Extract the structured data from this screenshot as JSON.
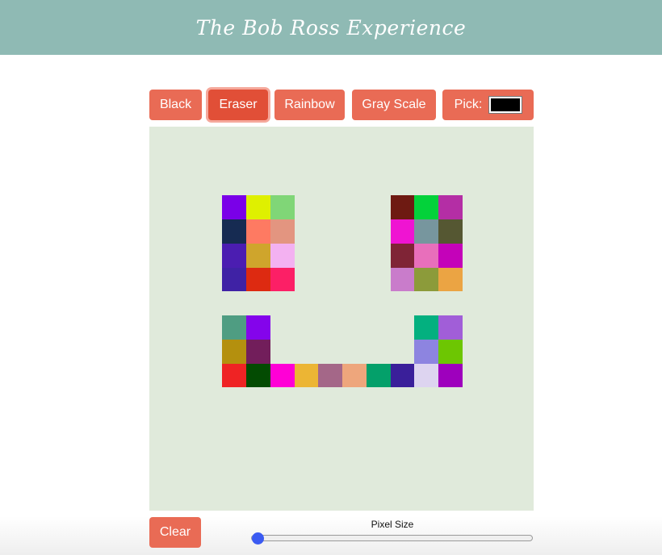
{
  "header": {
    "title": "The Bob Ross Experience"
  },
  "toolbar": {
    "black_label": "Black",
    "eraser_label": "Eraser",
    "rainbow_label": "Rainbow",
    "grayscale_label": "Gray Scale",
    "pick_label": "Pick:",
    "pick_color": "#000000",
    "active_mode": "Eraser"
  },
  "canvas": {
    "background": "#e0eadb",
    "grid_size": 16,
    "pixels": [
      {
        "col": 3,
        "row": 3,
        "color": "#7a00e8"
      },
      {
        "col": 4,
        "row": 3,
        "color": "#dff000"
      },
      {
        "col": 5,
        "row": 3,
        "color": "#80d677"
      },
      {
        "col": 3,
        "row": 4,
        "color": "#162b52"
      },
      {
        "col": 4,
        "row": 4,
        "color": "#fe7a62"
      },
      {
        "col": 5,
        "row": 4,
        "color": "#e39580"
      },
      {
        "col": 3,
        "row": 5,
        "color": "#4b1db1"
      },
      {
        "col": 4,
        "row": 5,
        "color": "#cfa52c"
      },
      {
        "col": 5,
        "row": 5,
        "color": "#f3b1f1"
      },
      {
        "col": 3,
        "row": 6,
        "color": "#3f22a5"
      },
      {
        "col": 4,
        "row": 6,
        "color": "#dd2a11"
      },
      {
        "col": 5,
        "row": 6,
        "color": "#fc1f66"
      },
      {
        "col": 10,
        "row": 3,
        "color": "#6e1a12"
      },
      {
        "col": 11,
        "row": 3,
        "color": "#03d23a"
      },
      {
        "col": 12,
        "row": 3,
        "color": "#b42ea5"
      },
      {
        "col": 10,
        "row": 4,
        "color": "#ef14d2"
      },
      {
        "col": 11,
        "row": 4,
        "color": "#77969e"
      },
      {
        "col": 12,
        "row": 4,
        "color": "#555732"
      },
      {
        "col": 10,
        "row": 5,
        "color": "#7f2436"
      },
      {
        "col": 11,
        "row": 5,
        "color": "#e86fbb"
      },
      {
        "col": 12,
        "row": 5,
        "color": "#c402b9"
      },
      {
        "col": 10,
        "row": 6,
        "color": "#c97ccb"
      },
      {
        "col": 11,
        "row": 6,
        "color": "#8c9b3a"
      },
      {
        "col": 12,
        "row": 6,
        "color": "#eba443"
      },
      {
        "col": 3,
        "row": 8,
        "color": "#4f9d82"
      },
      {
        "col": 4,
        "row": 8,
        "color": "#8404eb"
      },
      {
        "col": 3,
        "row": 9,
        "color": "#b4900e"
      },
      {
        "col": 4,
        "row": 9,
        "color": "#721e5b"
      },
      {
        "col": 11,
        "row": 8,
        "color": "#03b07f"
      },
      {
        "col": 12,
        "row": 8,
        "color": "#a15ed8"
      },
      {
        "col": 11,
        "row": 9,
        "color": "#8d84e0"
      },
      {
        "col": 12,
        "row": 9,
        "color": "#6dc602"
      },
      {
        "col": 3,
        "row": 10,
        "color": "#ef2324"
      },
      {
        "col": 4,
        "row": 10,
        "color": "#034b02"
      },
      {
        "col": 5,
        "row": 10,
        "color": "#ff00d6"
      },
      {
        "col": 6,
        "row": 10,
        "color": "#ecb534"
      },
      {
        "col": 7,
        "row": 10,
        "color": "#a46788"
      },
      {
        "col": 8,
        "row": 10,
        "color": "#eea67c"
      },
      {
        "col": 9,
        "row": 10,
        "color": "#04a06a"
      },
      {
        "col": 10,
        "row": 10,
        "color": "#3a1f9a"
      },
      {
        "col": 11,
        "row": 10,
        "color": "#ddd4f0"
      },
      {
        "col": 12,
        "row": 10,
        "color": "#9e00bd"
      }
    ]
  },
  "controls": {
    "clear_label": "Clear",
    "pixel_size_label": "Pixel Size",
    "pixel_size_value": 0
  }
}
